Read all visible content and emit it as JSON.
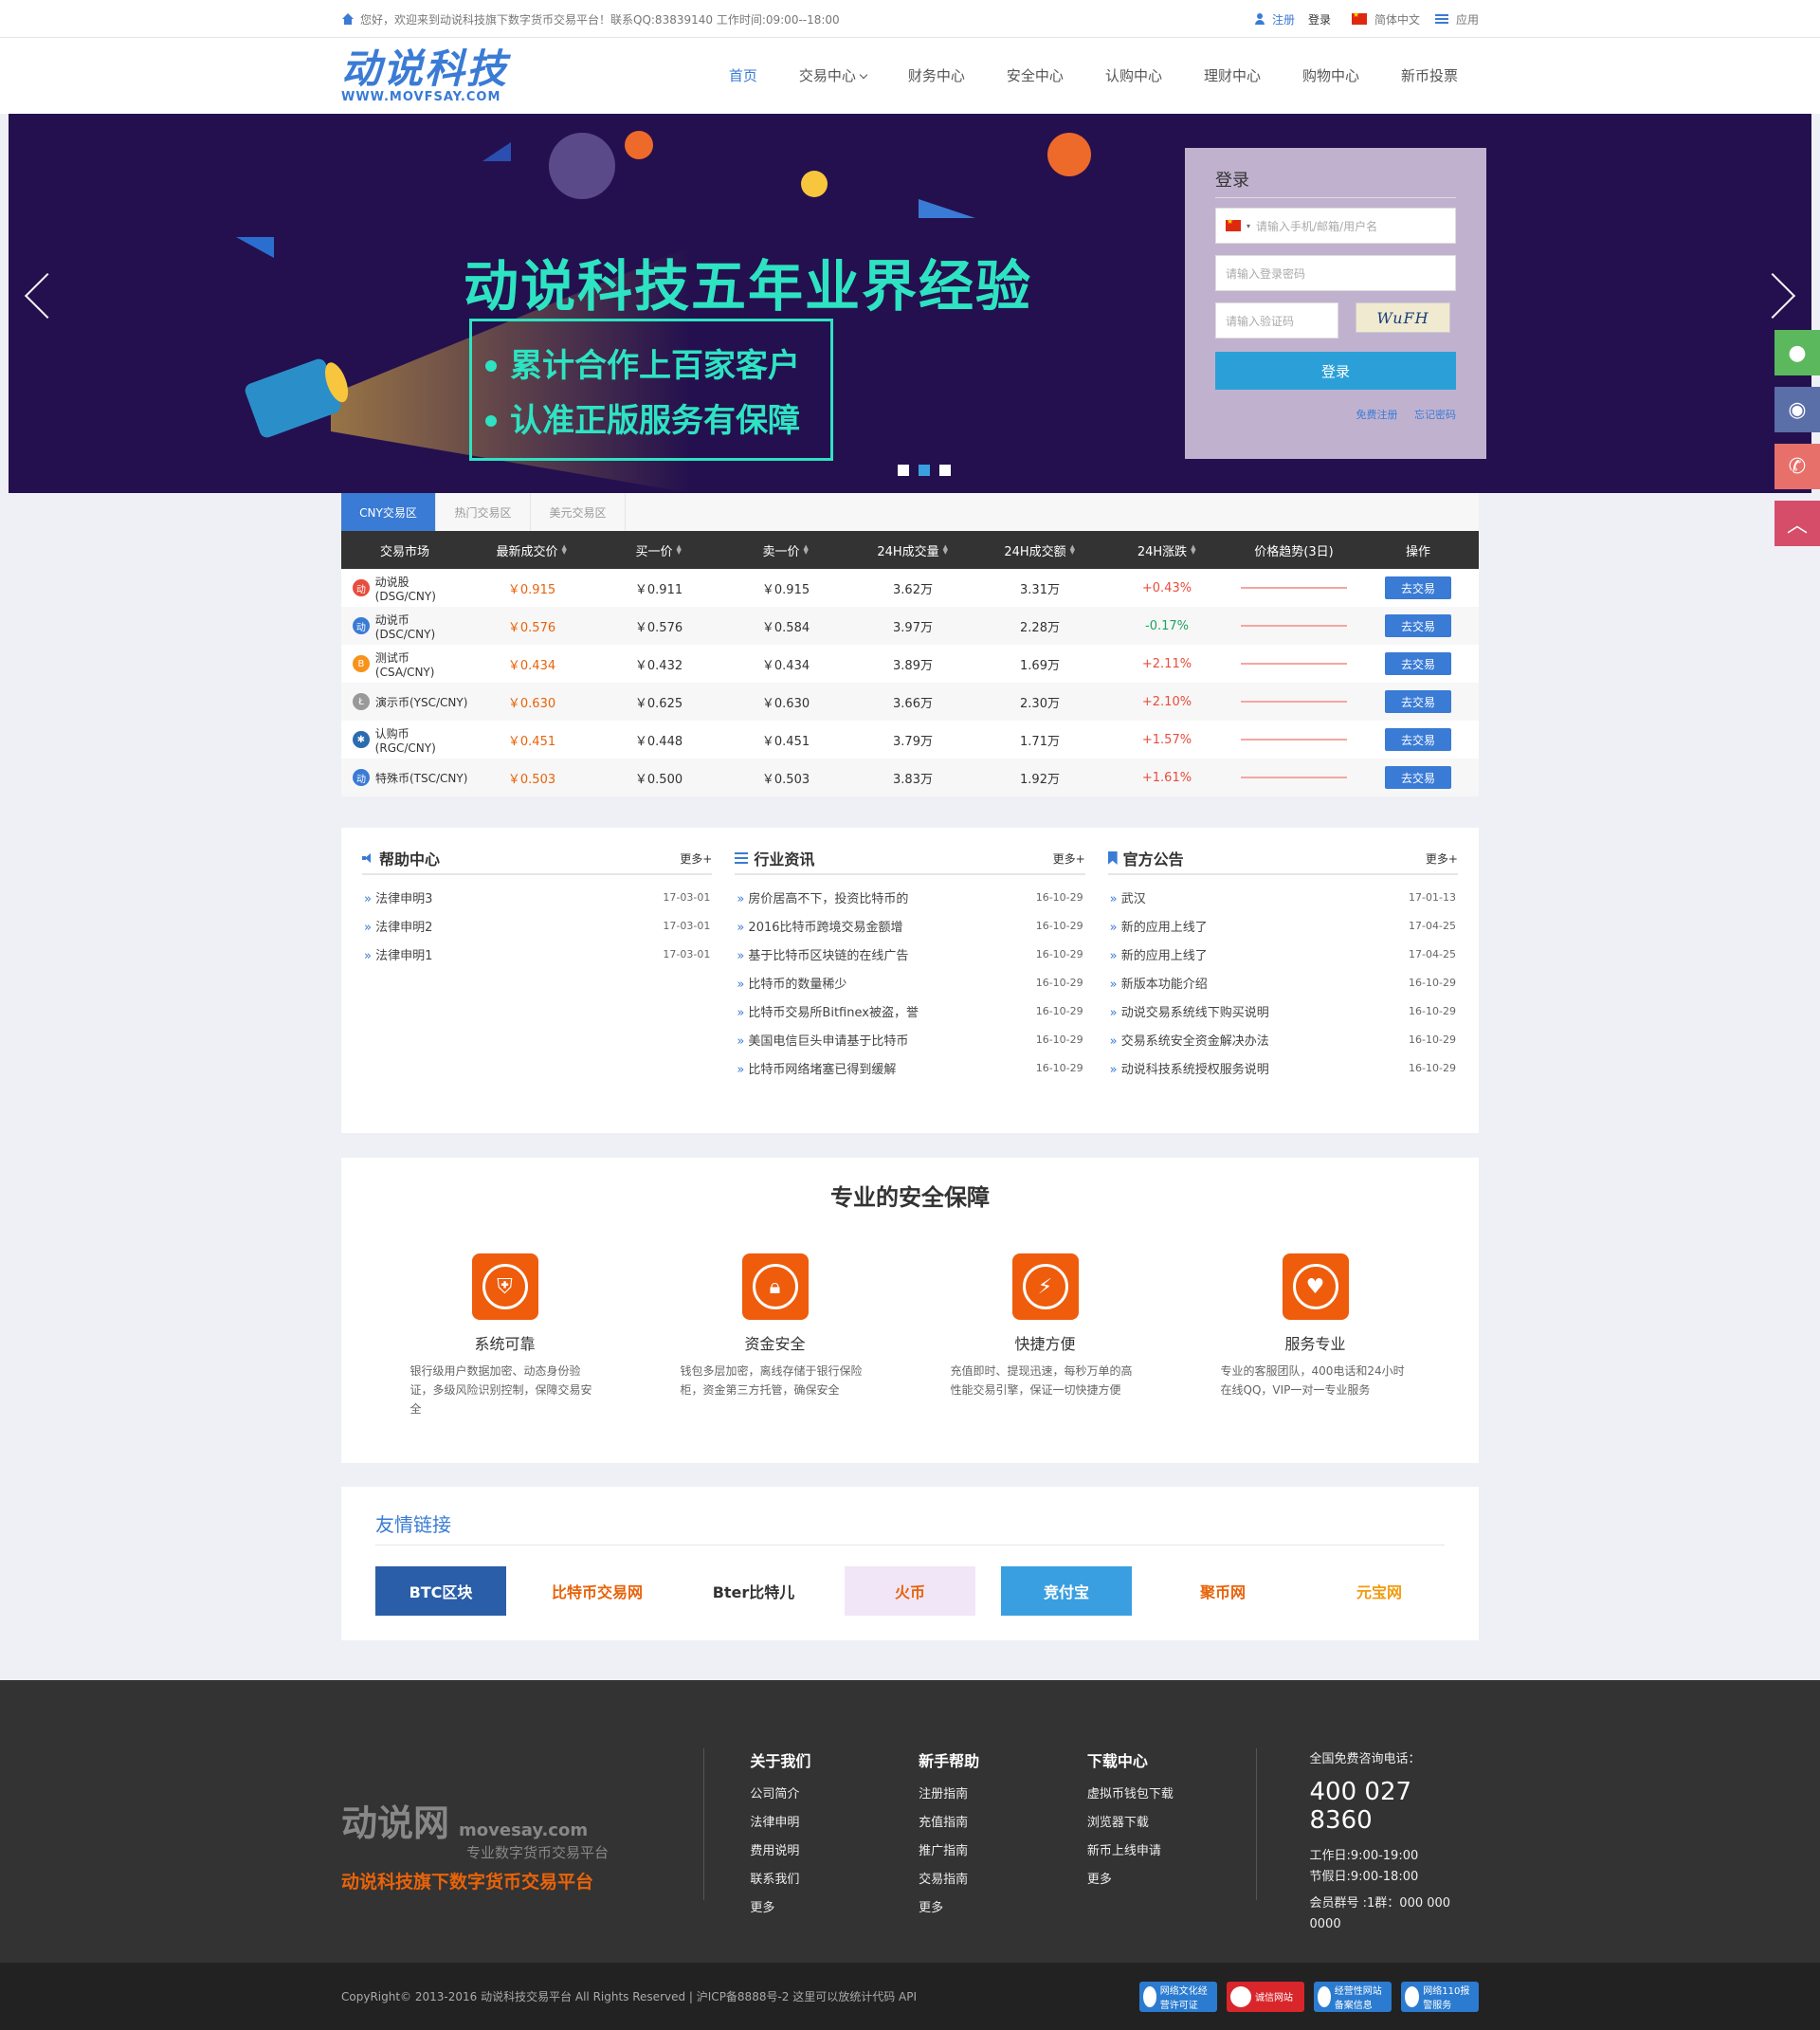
{
  "topbar": {
    "welcome": "您好，欢迎来到动说科技旗下数字货币交易平台！联系QQ:83839140 工作时间:09:00--18:00",
    "register": "注册",
    "login": "登录",
    "language": "简体中文",
    "apps": "应用"
  },
  "logo": {
    "cn": "动说科技",
    "en": "WWW.MOVFSAY.COM"
  },
  "nav": {
    "items": [
      {
        "label": "首页"
      },
      {
        "label": "交易中心"
      },
      {
        "label": "财务中心"
      },
      {
        "label": "安全中心"
      },
      {
        "label": "认购中心"
      },
      {
        "label": "理财中心"
      },
      {
        "label": "购物中心"
      },
      {
        "label": "新币投票"
      }
    ]
  },
  "banner": {
    "title": "动说科技五年业界经验",
    "lines": [
      "累计合作上百家客户",
      "认准正版服务有保障"
    ],
    "active_slide": 2,
    "slide_count": 3
  },
  "login": {
    "title": "登录",
    "username_placeholder": "请输入手机/邮箱/用户名",
    "password_placeholder": "请输入登录密码",
    "captcha_placeholder": "请输入验证码",
    "captcha_text": "WuFH",
    "submit": "登录",
    "free_register": "免费注册",
    "forgot": "忘记密码"
  },
  "market": {
    "tabs": [
      "CNY交易区",
      "热门交易区",
      "美元交易区"
    ],
    "active_tab": 0,
    "columns": [
      "交易市场",
      "最新成交价",
      "买一价",
      "卖一价",
      "24H成交量",
      "24H成交额",
      "24H涨跌",
      "价格趋势(3日)",
      "操作"
    ],
    "rows": [
      {
        "name": "动说股(DSG/CNY)",
        "last": "￥0.915",
        "buy": "￥0.911",
        "sell": "￥0.915",
        "vol": "3.62万",
        "amount": "3.31万",
        "change": "+0.43%",
        "action": "去交易",
        "icon_color": "#e84c3d",
        "icon": "动"
      },
      {
        "name": "动说币(DSC/CNY)",
        "last": "￥0.576",
        "buy": "￥0.576",
        "sell": "￥0.584",
        "vol": "3.97万",
        "amount": "2.28万",
        "change": "-0.17%",
        "action": "去交易",
        "icon_color": "#3a7bd5",
        "icon": "动"
      },
      {
        "name": "测试币(CSA/CNY)",
        "last": "￥0.434",
        "buy": "￥0.432",
        "sell": "￥0.434",
        "vol": "3.89万",
        "amount": "1.69万",
        "change": "+2.11%",
        "action": "去交易",
        "icon_color": "#f7931a",
        "icon": "B"
      },
      {
        "name": "演示币(YSC/CNY)",
        "last": "￥0.630",
        "buy": "￥0.625",
        "sell": "￥0.630",
        "vol": "3.66万",
        "amount": "2.30万",
        "change": "+2.10%",
        "action": "去交易",
        "icon_color": "#999999",
        "icon": "Ł"
      },
      {
        "name": "认购币(RGC/CNY)",
        "last": "￥0.451",
        "buy": "￥0.448",
        "sell": "￥0.451",
        "vol": "3.79万",
        "amount": "1.71万",
        "change": "+1.57%",
        "action": "去交易",
        "icon_color": "#2b6cb0",
        "icon": "✱"
      },
      {
        "name": "特殊币(TSC/CNY)",
        "last": "￥0.503",
        "buy": "￥0.500",
        "sell": "￥0.503",
        "vol": "3.83万",
        "amount": "1.92万",
        "change": "+1.61%",
        "action": "去交易",
        "icon_color": "#3a7bd5",
        "icon": "动"
      }
    ]
  },
  "news": {
    "more": "更多+",
    "help": {
      "title": "帮助中心",
      "items": [
        {
          "t": "法律申明3",
          "d": "17-03-01"
        },
        {
          "t": "法律申明2",
          "d": "17-03-01"
        },
        {
          "t": "法律申明1",
          "d": "17-03-01"
        }
      ]
    },
    "industry": {
      "title": "行业资讯",
      "items": [
        {
          "t": "房价居高不下，投资比特币的",
          "d": "16-10-29"
        },
        {
          "t": "2016比特币跨境交易金额增",
          "d": "16-10-29"
        },
        {
          "t": "基于比特币区块链的在线广告",
          "d": "16-10-29"
        },
        {
          "t": "比特币的数量稀少",
          "d": "16-10-29"
        },
        {
          "t": "比特币交易所Bitfinex被盗，誉",
          "d": "16-10-29"
        },
        {
          "t": "美国电信巨头申请基于比特币",
          "d": "16-10-29"
        },
        {
          "t": "比特币网络堵塞已得到缓解",
          "d": "16-10-29"
        }
      ]
    },
    "notice": {
      "title": "官方公告",
      "items": [
        {
          "t": "武汉",
          "d": "17-01-13"
        },
        {
          "t": "新的应用上线了",
          "d": "17-04-25"
        },
        {
          "t": "新的应用上线了",
          "d": "17-04-25"
        },
        {
          "t": "新版本功能介绍",
          "d": "16-10-29"
        },
        {
          "t": "动说交易系统线下购买说明",
          "d": "16-10-29"
        },
        {
          "t": "交易系统安全资金解决办法",
          "d": "16-10-29"
        },
        {
          "t": "动说科技系统授权服务说明",
          "d": "16-10-29"
        }
      ]
    }
  },
  "security": {
    "title": "专业的安全保障",
    "items": [
      {
        "title": "系统可靠",
        "desc": "银行级用户数据加密、动态身份验证，多级风险识别控制，保障交易安全",
        "icon": "shield"
      },
      {
        "title": "资金安全",
        "desc": "钱包多层加密，离线存储于银行保险柜，资金第三方托管，确保安全",
        "icon": "lock"
      },
      {
        "title": "快捷方便",
        "desc": "充值即时、提现迅速，每秒万单的高性能交易引擎，保证一切快捷方便",
        "icon": "bolt"
      },
      {
        "title": "服务专业",
        "desc": "专业的客服团队，400电话和24小时在线QQ，VIP一对一专业服务",
        "icon": "heart"
      }
    ]
  },
  "friends": {
    "title": "友情链接",
    "partners": [
      {
        "name": "BTC区块",
        "bg": "#2a5ea8",
        "fg": "#ffffff"
      },
      {
        "name": "比特币交易网",
        "bg": "#ffffff",
        "fg": "#e8630a"
      },
      {
        "name": "Bter比特儿",
        "bg": "#ffffff",
        "fg": "#333333"
      },
      {
        "name": "火币",
        "bg": "#f1e6f8",
        "fg": "#e8630a"
      },
      {
        "name": "竞付宝",
        "bg": "#3a9fe0",
        "fg": "#ffffff"
      },
      {
        "name": "聚币网",
        "bg": "#ffffff",
        "fg": "#e8630a"
      },
      {
        "name": "元宝网",
        "bg": "#ffffff",
        "fg": "#f29b12"
      }
    ]
  },
  "footer": {
    "brand": "动说网",
    "brand_domain": "movesay.com",
    "brand_sub": "专业数字货币交易平台",
    "brand_slogan": "动说科技旗下数字货币交易平台",
    "about": {
      "title": "关于我们",
      "links": [
        "公司简介",
        "法律申明",
        "费用说明",
        "联系我们",
        "更多"
      ]
    },
    "guide": {
      "title": "新手帮助",
      "links": [
        "注册指南",
        "充值指南",
        "推广指南",
        "交易指南",
        "更多"
      ]
    },
    "download": {
      "title": "下载中心",
      "links": [
        "虚拟币钱包下载",
        "浏览器下载",
        "新币上线申请",
        "更多"
      ]
    },
    "contact": {
      "label": "全国免费咨询电话：",
      "phone": "400 027 8360",
      "workday": "工作日:9:00-19:00",
      "holiday": "节假日:9:00-18:00",
      "group": "会员群号 :1群：000 000 0000"
    },
    "copyright": "CopyRight© 2013-2016 动说科技交易平台 All Rights Reserved   |   沪ICP备8888号-2   这里可以放统计代码 API",
    "badges": [
      {
        "text": "网络文化经营许可证",
        "color": "#2b7bd0"
      },
      {
        "text": "诚信网站",
        "color": "#d9262b"
      },
      {
        "text": "经营性网站备案信息",
        "color": "#2b7bd0"
      },
      {
        "text": "网络110报警服务",
        "color": "#2b7bd0"
      }
    ]
  },
  "colors": {
    "brand": "#3a7bd5",
    "accent": "#ee5c0c",
    "up": "#e84c3d",
    "down": "#1ea362",
    "banner_text": "#2ee3c2"
  }
}
